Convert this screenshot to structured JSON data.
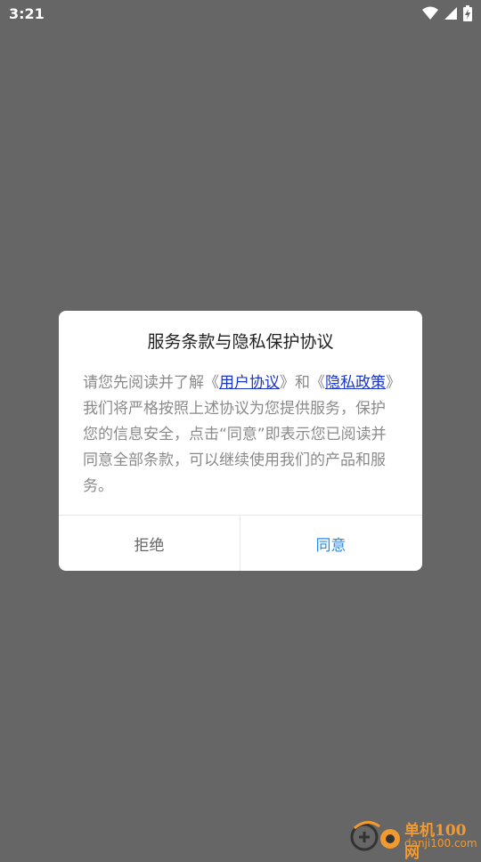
{
  "status_bar": {
    "time": "3:21",
    "icons": [
      "wifi-icon",
      "signal-icon",
      "battery-charging-icon"
    ]
  },
  "dialog": {
    "title": "服务条款与隐私保护协议",
    "body": {
      "part1": "请您先阅读并了解《",
      "link_user_agreement": "用户协议",
      "part2": "》和《",
      "link_privacy_policy": "隐私政策",
      "part3": "》我们将严格按照上述协议为您提供服务，保护您的信息安全，点击“同意”即表示您已阅读并同意全部条款，可以继续使用我们的产品和服务。"
    },
    "buttons": {
      "reject": "拒绝",
      "agree": "同意"
    }
  },
  "watermark": {
    "site_name": "单机100网",
    "site_url": "danji100.com"
  },
  "colors": {
    "overlay": "#666666",
    "link": "#1a36c9",
    "agree_text": "#2a8be6",
    "watermark": "#f29a30"
  }
}
